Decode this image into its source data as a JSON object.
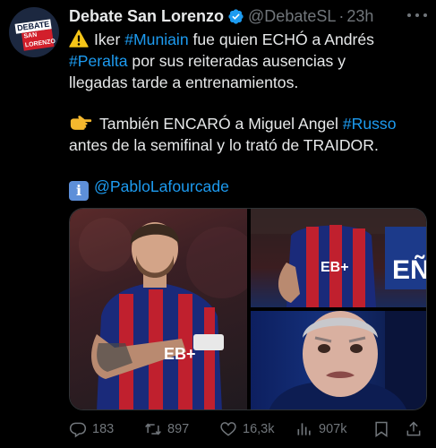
{
  "account": {
    "display_name": "Debate San Lorenzo",
    "handle": "@DebateSL",
    "separator": "·",
    "time": "23h",
    "avatar_text_top": "DEBATE",
    "avatar_text_bottom": "SAN LORENZO"
  },
  "tweet": {
    "l1_pre": "Iker ",
    "l1_tag": "#Muniain",
    "l1_post": " fue quien ECHÓ a Andrés",
    "l2_tag": "#Peralta",
    "l2_post": " por sus reiteradas ausencias y",
    "l3": "llegadas tarde a entrenamientos.",
    "l4_pre": "También ENCARÓ a Miguel Angel ",
    "l4_tag": "#Russo",
    "l5": "antes de la semifinal y lo trató de TRAIDOR.",
    "l6_mention": "@PabloLafourcade",
    "info_glyph": "i"
  },
  "media": {
    "photo_1_jersey_text": "EB+",
    "photo_2_jersey_text": "EB+",
    "photo_2_bg_text": "EÑ"
  },
  "actions": {
    "replies": "183",
    "reposts": "897",
    "likes": "16,3k",
    "views": "907k"
  },
  "colors": {
    "background": "#000000",
    "text": "#e7e9ea",
    "muted": "#71767b",
    "link": "#1d9bf0",
    "verified": "#1d9bf0"
  }
}
